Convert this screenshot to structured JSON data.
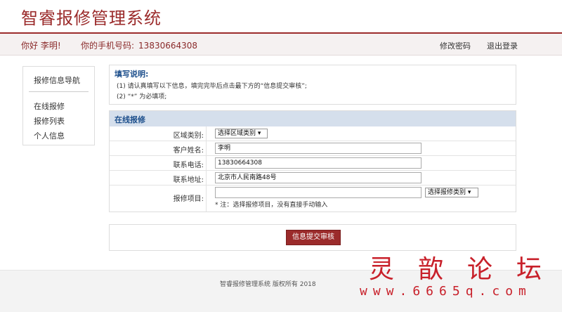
{
  "header": {
    "title": "智睿报修管理系统",
    "greeting": "你好 李明!",
    "phone_label": "你的手机号码:",
    "phone_value": "13830664308",
    "change_password": "修改密码",
    "logout": "退出登录"
  },
  "sidebar": {
    "title": "报修信息导航",
    "items": [
      {
        "label": "在线报修"
      },
      {
        "label": "报修列表"
      },
      {
        "label": "个人信息"
      }
    ]
  },
  "notice": {
    "title": "填写说明:",
    "lines": [
      "(1) 请认真填写以下信息，填完完毕后点击最下方的“信息提交审核”;",
      "(2) “*” 为必填项;"
    ]
  },
  "form": {
    "heading": "在线报修",
    "region_label": "区域类别:",
    "region_select": "选择区域类别 ▾",
    "name_label": "客户姓名:",
    "name_value": "李明",
    "phone_label": "联系电话:",
    "phone_value": "13830664308",
    "address_label": "联系地址:",
    "address_value": "北京市人民南路48号",
    "item_label": "报修项目:",
    "item_value": "",
    "item_select": "选择报修类别 ▾",
    "note": "* 注：选择报修项目，没有直接手动输入"
  },
  "submit_label": "信息提交审核",
  "footer": {
    "copyright": "智睿报修管理系统  版权所有   2018"
  },
  "watermark": {
    "title": "灵歆论坛",
    "url": "www.6665q.com"
  },
  "colors": {
    "brand": "#9b2b2b",
    "heading_blue": "#1d4f8c",
    "section_bg": "#d5dfec",
    "watermark": "#c8202a"
  }
}
